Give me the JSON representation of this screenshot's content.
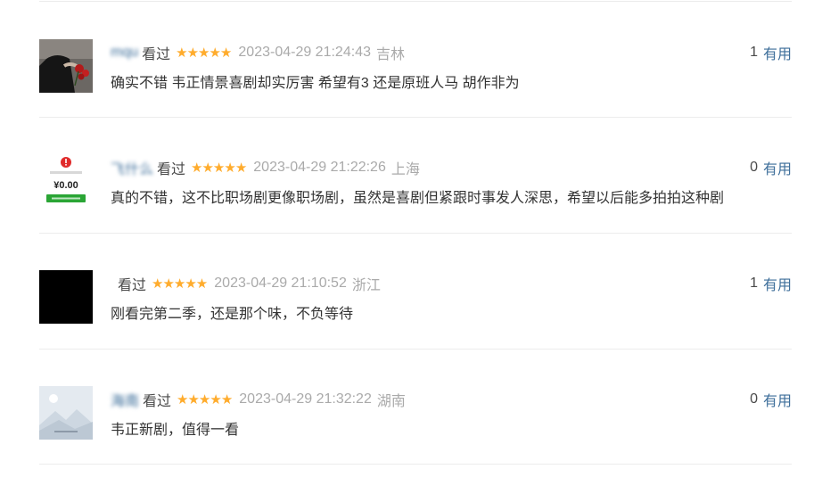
{
  "vote_label": "有用",
  "watched_label": "看过",
  "stars_glyph": "★★★★★",
  "comments": [
    {
      "user": "mqu",
      "avatar_icon": "rose-photo-avatar-icon",
      "watched": "看过",
      "rating_stars": 5,
      "time": "2023-04-29 21:24:43",
      "location": "吉林",
      "votes": "1",
      "text": "确实不错 韦正情景喜剧却实厉害 希望有3 还是原班人马 胡作非为"
    },
    {
      "user": "飞什么",
      "avatar_icon": "payment-zero-avatar-icon",
      "watched": "看过",
      "rating_stars": 5,
      "time": "2023-04-29 21:22:26",
      "location": "上海",
      "votes": "0",
      "text": "真的不错，这不比职场剧更像职场剧，虽然是喜剧但紧跟时事发人深思，希望以后能多拍拍这种剧",
      "avatar_amount": "¥0.00"
    },
    {
      "user": "",
      "avatar_icon": "black-avatar-icon",
      "watched": "看过",
      "rating_stars": 5,
      "time": "2023-04-29 21:10:52",
      "location": "浙江",
      "votes": "1",
      "text": "刚看完第二季，还是那个味，不负等待"
    },
    {
      "user": "海南",
      "avatar_icon": "landscape-avatar-icon",
      "watched": "看过",
      "rating_stars": 5,
      "time": "2023-04-29 21:32:22",
      "location": "湖南",
      "votes": "0",
      "text": "韦正新剧，值得一看"
    }
  ]
}
